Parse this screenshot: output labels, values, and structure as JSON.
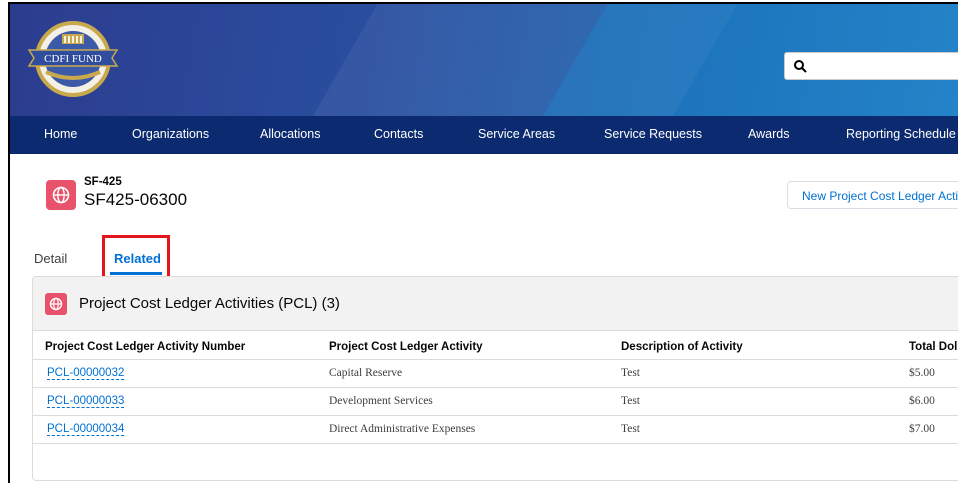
{
  "logo": {
    "text": "CDFI FUND"
  },
  "search": {
    "placeholder": ""
  },
  "nav": {
    "items": [
      "Home",
      "Organizations",
      "Allocations",
      "Contacts",
      "Service Areas",
      "Service Requests",
      "Awards",
      "Reporting Schedule"
    ]
  },
  "record": {
    "type_label": "SF-425",
    "name": "SF425-06300",
    "new_button": "New Project Cost Ledger Activity"
  },
  "tabs": {
    "detail": "Detail",
    "related": "Related",
    "active": "Related"
  },
  "related_list": {
    "title": "Project Cost Ledger Activities (PCL) (3)",
    "columns": [
      "Project Cost Ledger Activity Number",
      "Project Cost Ledger Activity",
      "Description of Activity",
      "Total Doll"
    ],
    "rows": [
      {
        "number": "PCL-00000032",
        "activity": "Capital Reserve",
        "description": "Test",
        "total": "$5.00"
      },
      {
        "number": "PCL-00000033",
        "activity": "Development Services",
        "description": "Test",
        "total": "$6.00"
      },
      {
        "number": "PCL-00000034",
        "activity": "Direct Administrative Expenses",
        "description": "Test",
        "total": "$7.00"
      }
    ]
  },
  "colors": {
    "nav_bg": "#0b2a6f",
    "accent": "#0070d2",
    "record_icon": "#e8536b",
    "highlight": "#e3141b"
  }
}
